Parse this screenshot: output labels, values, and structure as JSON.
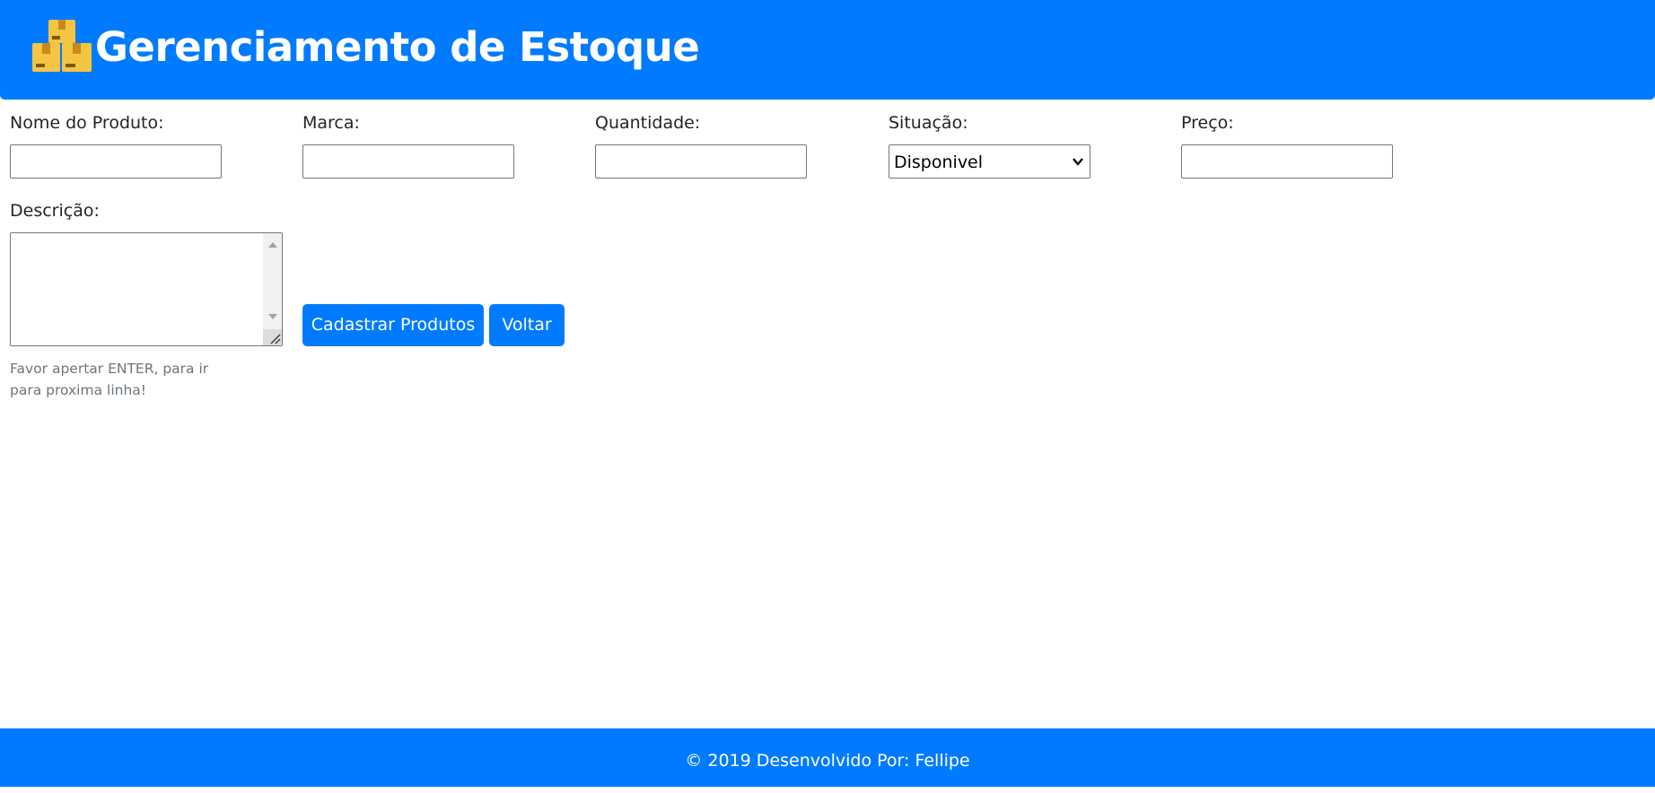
{
  "header": {
    "title": "Gerenciamento de Estoque",
    "logo_icon": "boxes-icon"
  },
  "form": {
    "nome": {
      "label": "Nome do Produto:",
      "value": ""
    },
    "marca": {
      "label": "Marca:",
      "value": ""
    },
    "quantidade": {
      "label": "Quantidade:",
      "value": ""
    },
    "situacao": {
      "label": "Situação:",
      "selected": "Disponivel"
    },
    "preco": {
      "label": "Preço:",
      "value": ""
    },
    "descricao": {
      "label": "Descrição:",
      "value": "",
      "hint": "Favor apertar ENTER, para ir para proxima linha!"
    },
    "submit_label": "Cadastrar Produtos",
    "back_label": "Voltar"
  },
  "footer": {
    "text": "© 2019 Desenvolvido Por: Fellipe"
  },
  "colors": {
    "primary": "#007bff",
    "text": "#212529",
    "muted": "#6c757d"
  }
}
